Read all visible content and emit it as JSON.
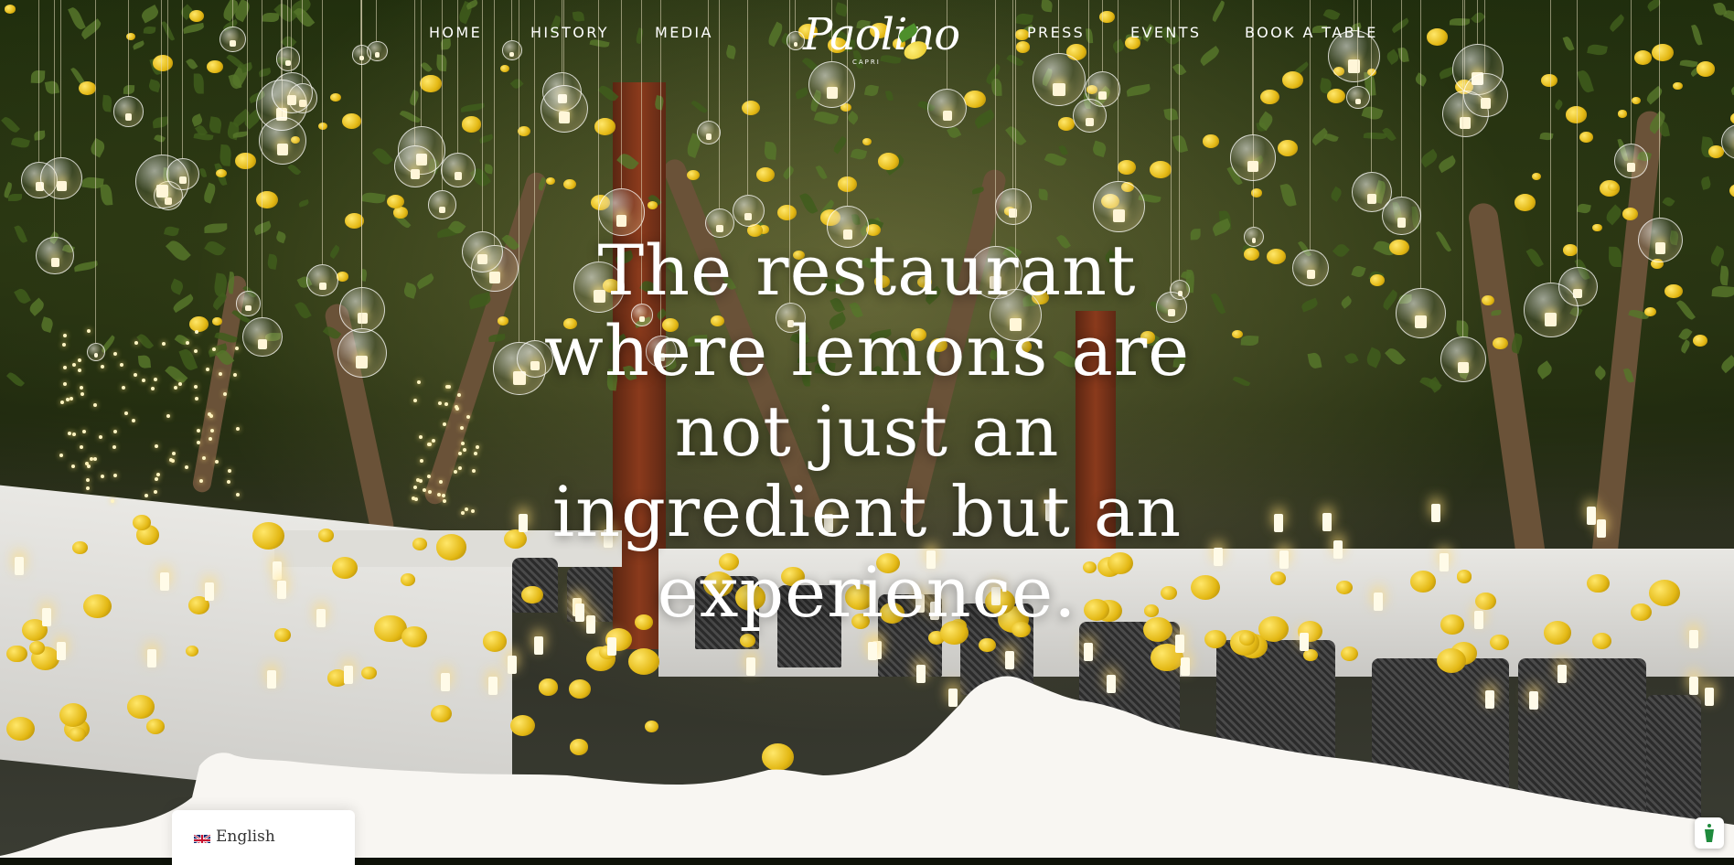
{
  "nav": {
    "home": "HOME",
    "history": "HISTORY",
    "media": "MEDIA",
    "press": "PRESS",
    "events": "EVENTS",
    "book": "BOOK A TABLE"
  },
  "logo": {
    "name": "Paolino",
    "sub": "CAPRI"
  },
  "hero": {
    "headline": "The restaurant where lemons are not just an ingredient but an experience."
  },
  "language": {
    "label": "English",
    "flag_icon": "uk-flag-icon"
  },
  "consent": {
    "icon": "privacy-consent-icon",
    "color": "#1e8a3c"
  },
  "colors": {
    "accent": "#f2c51d",
    "background_bottom": "#f8f6f2"
  }
}
